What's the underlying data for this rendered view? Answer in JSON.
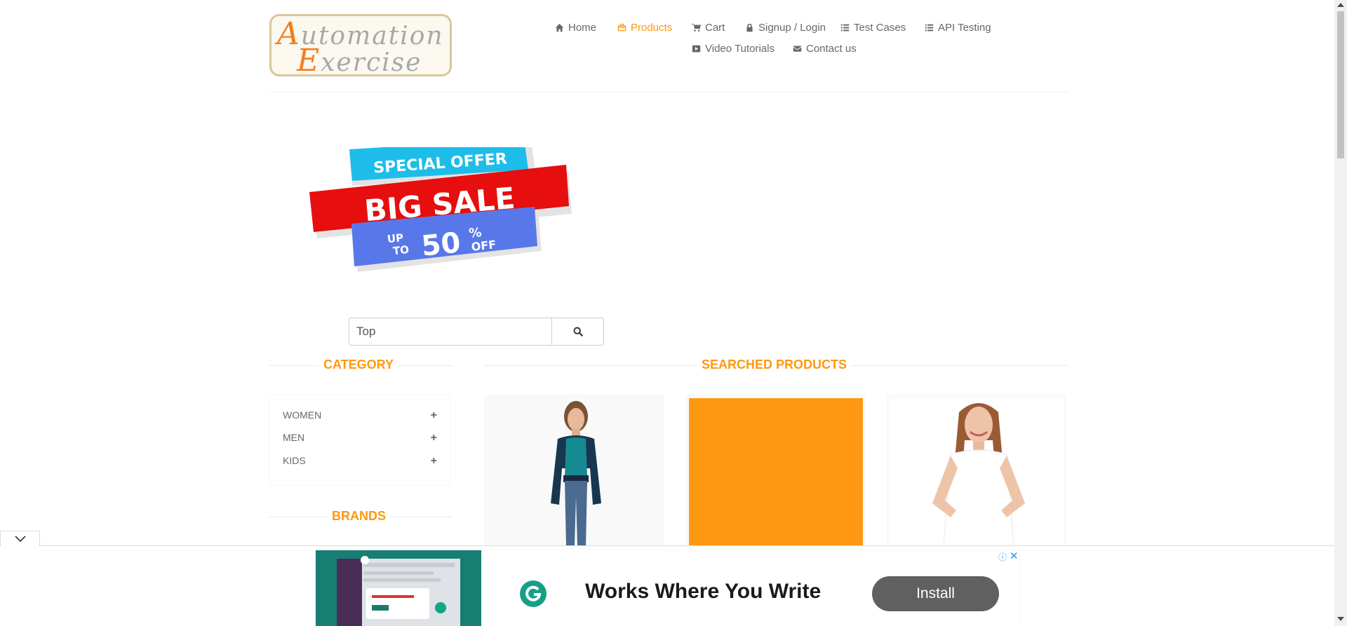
{
  "brand": {
    "logo_line1": "Automation",
    "logo_line2": "Exercise"
  },
  "nav": {
    "items": [
      {
        "label": "Home",
        "icon": "home-icon",
        "active": false
      },
      {
        "label": "Products",
        "icon": "shopping-bag-icon",
        "active": true
      },
      {
        "label": "Cart",
        "icon": "cart-icon",
        "active": false
      },
      {
        "label": "Signup / Login",
        "icon": "lock-icon",
        "active": false
      },
      {
        "label": "Test Cases",
        "icon": "list-icon",
        "active": false
      },
      {
        "label": "API Testing",
        "icon": "list-icon",
        "active": false
      },
      {
        "label": "Video Tutorials",
        "icon": "youtube-icon",
        "active": false
      },
      {
        "label": "Contact us",
        "icon": "envelope-icon",
        "active": false
      }
    ]
  },
  "banner": {
    "line1": "SPECIAL OFFER",
    "line2": "BIG SALE",
    "up": "UP",
    "to": "TO",
    "number": "50",
    "percent": "%",
    "off": "OFF"
  },
  "search": {
    "value": "Top",
    "button_icon": "search-icon"
  },
  "sidebar": {
    "category_title": "Category",
    "categories": [
      {
        "label": "Women"
      },
      {
        "label": "Men"
      },
      {
        "label": "Kids"
      }
    ],
    "brands_title": "Brands"
  },
  "main": {
    "title": "Searched Products"
  },
  "ad": {
    "headline": "Works Where You Write",
    "install_label": "Install",
    "info_icon": "info-icon",
    "close_icon": "close-icon"
  },
  "colors": {
    "accent": "#fe980f",
    "text": "#696763",
    "ad_teal": "#177e74",
    "ad_button": "#606060"
  }
}
